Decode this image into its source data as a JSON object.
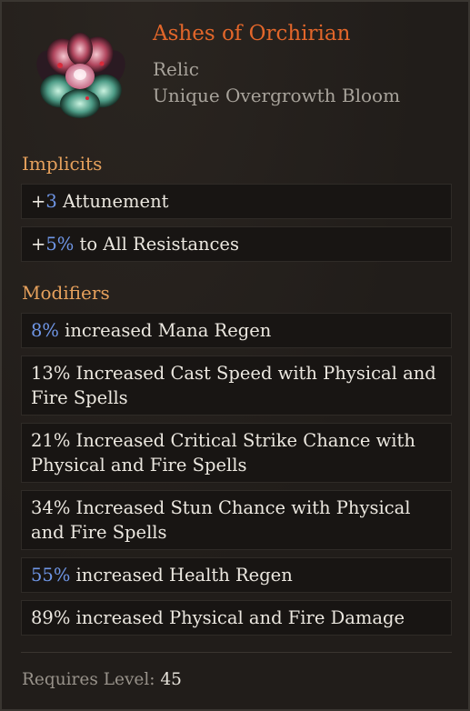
{
  "item": {
    "name": "Ashes of Orchirian",
    "type": "Relic",
    "subtype": "Unique Overgrowth Bloom",
    "icon": "overgrowth-bloom-flower-icon"
  },
  "implicits": {
    "title": "Implicits",
    "mods": [
      {
        "value": "+3",
        "text": " Attunement",
        "value_color": "blue",
        "prefix": "+",
        "num": "3"
      },
      {
        "value": "+5%",
        "text": " to All Resistances",
        "value_color": "blue",
        "prefix": "+",
        "num": "5%"
      }
    ]
  },
  "modifiers": {
    "title": "Modifiers",
    "mods": [
      {
        "value": "8%",
        "text": " increased Mana Regen",
        "value_color": "blue"
      },
      {
        "value": "13%",
        "text": " Increased Cast Speed with Physical and Fire Spells",
        "value_color": "white"
      },
      {
        "value": "21%",
        "text": " Increased Critical Strike Chance with Physical and Fire Spells",
        "value_color": "white"
      },
      {
        "value": "34%",
        "text": " Increased Stun Chance with Physical and Fire Spells",
        "value_color": "white"
      },
      {
        "value": "55%",
        "text": " increased Health Regen",
        "value_color": "blue"
      },
      {
        "value": "89%",
        "text": " increased Physical and Fire Damage",
        "value_color": "white"
      }
    ]
  },
  "requirements": {
    "label": "Requires Level: ",
    "level": "45"
  },
  "colors": {
    "unique_name": "#e2662a",
    "section_title": "#e5a05c",
    "value_blue": "#6f96e6",
    "background": "#211d1a"
  }
}
